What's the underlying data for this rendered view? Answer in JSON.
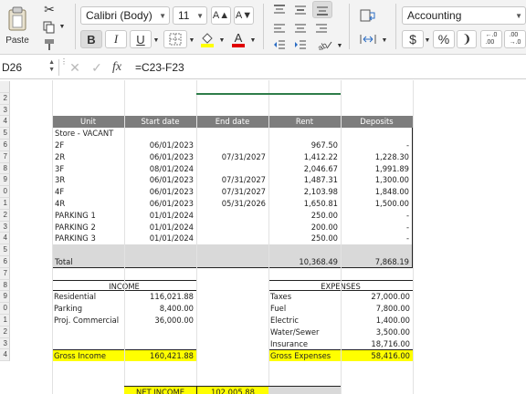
{
  "ribbon": {
    "paste_label": "Paste",
    "font_name": "Calibri (Body)",
    "font_size": "11",
    "grow_font": "A▲",
    "shrink_font": "A▼",
    "bold": "B",
    "italic": "I",
    "underline": "U",
    "number_format": "Accounting",
    "currency": "$",
    "percent": "%",
    "comma": "❩",
    "inc_decimal": "←.0\n.00",
    "dec_decimal": ".00\n→.0",
    "colors": {
      "highlight": "#ffff00",
      "font_color": "#e00000"
    }
  },
  "formula_bar": {
    "name_box": "D26",
    "formula": "=C23-F23"
  },
  "sheet": {
    "table_header": [
      "Unit",
      "Start date",
      "End date",
      "Rent",
      "Deposits"
    ],
    "row_labels": [
      "",
      "2",
      "3",
      "4",
      "5",
      "6",
      "7",
      "8",
      "9",
      "0",
      "1",
      "2",
      "3",
      "4",
      "5",
      "6",
      "7",
      "8",
      "9",
      "0",
      "1",
      "2",
      "3",
      "4"
    ],
    "units": [
      {
        "unit": "Store - VACANT",
        "start": "",
        "end": "",
        "rent": "",
        "deposit": ""
      },
      {
        "unit": "2F",
        "start": "06/01/2023",
        "end": "",
        "rent": "967.50",
        "deposit": "-"
      },
      {
        "unit": "2R",
        "start": "06/01/2023",
        "end": "07/31/2027",
        "rent": "1,412.22",
        "deposit": "1,228.30"
      },
      {
        "unit": "3F",
        "start": "08/01/2024",
        "end": "",
        "rent": "2,046.67",
        "deposit": "1,991.89"
      },
      {
        "unit": "3R",
        "start": "06/01/2023",
        "end": "07/31/2027",
        "rent": "1,487.31",
        "deposit": "1,300.00"
      },
      {
        "unit": "4F",
        "start": "06/01/2023",
        "end": "07/31/2027",
        "rent": "2,103.98",
        "deposit": "1,848.00"
      },
      {
        "unit": "4R",
        "start": "06/01/2023",
        "end": "05/31/2026",
        "rent": "1,650.81",
        "deposit": "1,500.00"
      },
      {
        "unit": "PARKING 1",
        "start": "01/01/2024",
        "end": "",
        "rent": "250.00",
        "deposit": "-"
      },
      {
        "unit": "PARKING 2",
        "start": "01/01/2024",
        "end": "",
        "rent": "200.00",
        "deposit": "-"
      },
      {
        "unit": "PARKING 3",
        "start": "01/01/2024",
        "end": "",
        "rent": "250.00",
        "deposit": "-"
      }
    ],
    "total": {
      "label": "Total",
      "rent": "10,368.49",
      "deposit": "7,868.19"
    },
    "income": {
      "header": "INCOME",
      "items": [
        {
          "label": "Residential",
          "value": "116,021.88"
        },
        {
          "label": "Parking",
          "value": "8,400.00"
        },
        {
          "label": "Proj. Commercial",
          "value": "36,000.00"
        }
      ],
      "gross_label": "Gross Income",
      "gross_value": "160,421.88"
    },
    "expenses": {
      "header": "EXPENSES",
      "items": [
        {
          "label": "Taxes",
          "value": "27,000.00"
        },
        {
          "label": "Fuel",
          "value": "7,800.00"
        },
        {
          "label": "Electric",
          "value": "1,400.00"
        },
        {
          "label": "Water/Sewer",
          "value": "3,500.00"
        },
        {
          "label": "Insurance",
          "value": "18,716.00"
        }
      ],
      "gross_label": "Gross Expenses",
      "gross_value": "58,416.00"
    },
    "net_income": {
      "label": "NET INCOME",
      "value": "102,005.88"
    }
  }
}
